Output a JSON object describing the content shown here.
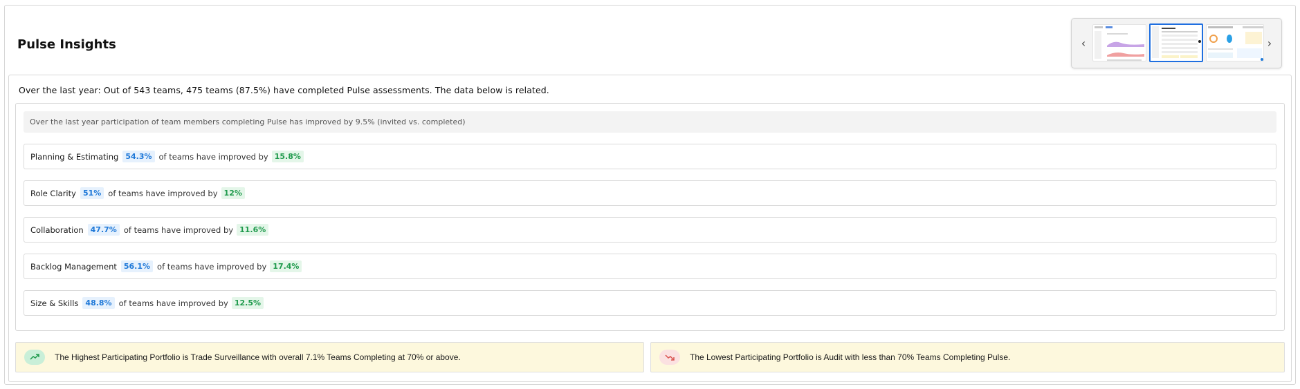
{
  "page": {
    "title": "Pulse Insights"
  },
  "carousel": {
    "prev_icon": "chevron-left-icon",
    "next_icon": "chevron-right-icon",
    "selected_index": 1,
    "thumbnail_count": 3
  },
  "insights": {
    "summary": "Over the last year: Out of 543 teams, 475 teams (87.5%) have completed Pulse assessments. The data below is related.",
    "participation": "Over the last year participation of team members completing Pulse has improved by 9.5% (invited vs. completed)",
    "middle_text": "of teams have improved by",
    "metrics": [
      {
        "name": "Planning & Estimating",
        "teams_pct": "54.3%",
        "improved_by": "15.8%"
      },
      {
        "name": "Role Clarity",
        "teams_pct": "51%",
        "improved_by": "12%"
      },
      {
        "name": "Collaboration",
        "teams_pct": "47.7%",
        "improved_by": "11.6%"
      },
      {
        "name": "Backlog Management",
        "teams_pct": "56.1%",
        "improved_by": "17.4%"
      },
      {
        "name": "Size & Skills",
        "teams_pct": "48.8%",
        "improved_by": "12.5%"
      }
    ]
  },
  "portfolios": {
    "highest": {
      "text": "The Highest Participating Portfolio is Trade Surveillance with overall 7.1% Teams Completing at 70% or above.",
      "icon": "trending-up-icon"
    },
    "lowest": {
      "text": "The Lowest Participating Portfolio is Audit with less than 70% Teams Completing Pulse.",
      "icon": "trending-down-icon"
    }
  },
  "colors": {
    "accent_blue": "#1e78d8",
    "badge_blue_bg": "#e6f1fd",
    "accent_green": "#1f9a4c",
    "badge_green_bg": "#e4f6e9",
    "portfolio_bg": "#fdf8dd",
    "trend_down": "#d9534f",
    "selected_border": "#1f6fe0"
  }
}
